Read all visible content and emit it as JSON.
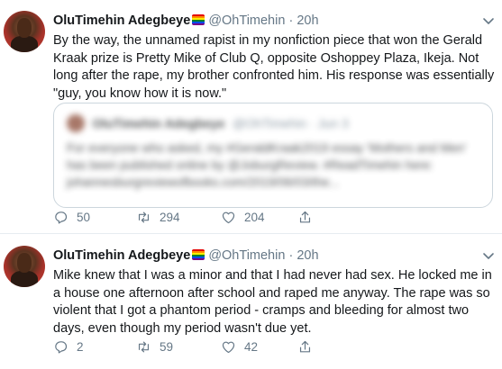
{
  "tweets": [
    {
      "name": "OluTimehin Adegbeye",
      "handle": "@OhTimehin",
      "separator": "·",
      "time": "20h",
      "text": "By the way, the unnamed rapist in my nonfiction piece that won the Gerald Kraak prize is Pretty Mike of Club Q, opposite Oshoppey Plaza, Ikeja. Not long after the rape, my brother confronted him. His response was essentially \"guy, you know how it is now.\"",
      "quote": {
        "name": "OluTimehin Adegbeye",
        "handle": "@OhTimehin · Jun 3",
        "text": "For everyone who asked, my #GeraldKraak2019 essay 'Mothers and Men' has been published online by @JoburgReview. #ReadTimehin here: johannesburgreviewofbooks.com/2019/06/03/the..."
      },
      "replies": "50",
      "retweets": "294",
      "likes": "204"
    },
    {
      "name": "OluTimehin Adegbeye",
      "handle": "@OhTimehin",
      "separator": "·",
      "time": "20h",
      "text": "Mike knew that I was a minor and that I had never had sex. He locked me in a house one afternoon after school and raped me anyway. The rape was so violent that I got a phantom period - cramps and bleeding for almost two days, even though my period wasn't due yet.",
      "replies": "2",
      "retweets": "59",
      "likes": "42"
    }
  ]
}
